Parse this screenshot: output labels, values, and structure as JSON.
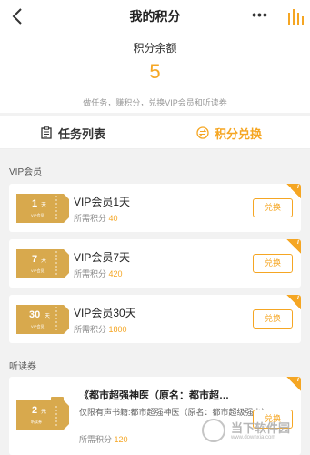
{
  "navbar": {
    "title": "我的积分",
    "more_label": "•••",
    "back_icon": "back-chevron-icon",
    "stats_icon": "bar-chart-icon"
  },
  "summary": {
    "label": "积分余额",
    "value": "5",
    "hint": "做任务，赚积分，兑换VIP会员和听读券"
  },
  "tabs": [
    {
      "label": "任务列表",
      "icon": "clipboard-icon",
      "active": false
    },
    {
      "label": "积分兑换",
      "icon": "exchange-icon",
      "active": true
    }
  ],
  "sections": {
    "vip_title": "VIP会员",
    "audio_title": "听读券"
  },
  "vip_items": [
    {
      "ticket_num": "1",
      "ticket_unit": "天",
      "ticket_sub": "VIP会员",
      "name": "VIP会员1天",
      "cost_label": "所需积分",
      "cost": "40",
      "button": "兑换"
    },
    {
      "ticket_num": "7",
      "ticket_unit": "天",
      "ticket_sub": "VIP会员",
      "name": "VIP会员7天",
      "cost_label": "所需积分",
      "cost": "420",
      "button": "兑换"
    },
    {
      "ticket_num": "30",
      "ticket_unit": "天",
      "ticket_sub": "VIP会员",
      "name": "VIP会员30天",
      "cost_label": "所需积分",
      "cost": "1800",
      "button": "兑换"
    }
  ],
  "audio_items": [
    {
      "ticket_num": "2",
      "ticket_unit": "元",
      "ticket_sub": "听读券",
      "title": "《都市超强神医（原名：都市超…",
      "desc": "仅限有声书籍:都市超强神医（原名：都市超级强少）",
      "cost_label": "所需积分",
      "cost": "120",
      "button": "兑换"
    }
  ],
  "watermark": {
    "line1": "当下软件园",
    "line2": "www.downxia.com"
  },
  "colors": {
    "accent": "#f5a623",
    "ticket": "#d8a94d"
  }
}
